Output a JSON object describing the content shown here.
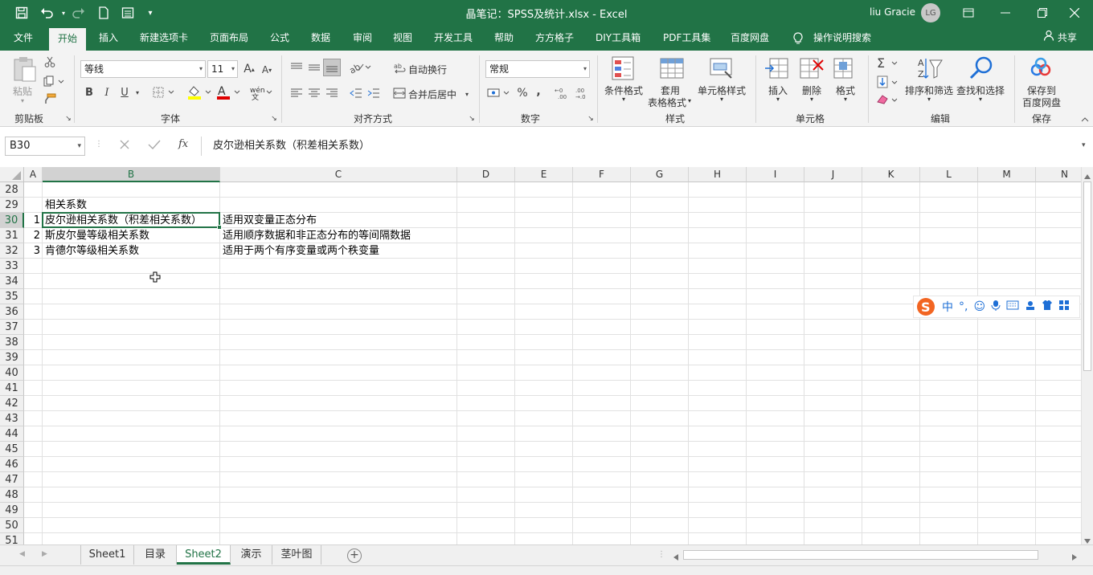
{
  "window": {
    "title": "晶笔记：SPSS及统计.xlsx  -  Excel",
    "user_name": "liu Gracie",
    "avatar_initials": "LG"
  },
  "quick_access": {
    "save_icon": "save-icon",
    "undo_icon": "undo-icon",
    "redo_icon": "redo-icon",
    "new_icon": "new-file-icon",
    "form_icon": "form-icon",
    "customize_icon": "customize-icon"
  },
  "menu_tabs": [
    "文件",
    "开始",
    "插入",
    "新建选项卡",
    "页面布局",
    "公式",
    "数据",
    "审阅",
    "视图",
    "开发工具",
    "帮助",
    "方方格子",
    "DIY工具箱",
    "PDF工具集",
    "百度网盘",
    "操作说明搜索"
  ],
  "share_label": "共享",
  "ribbon": {
    "clipboard": {
      "paste": "粘贴",
      "group": "剪贴板"
    },
    "font": {
      "name": "等线",
      "size": "11",
      "bold": "B",
      "italic": "I",
      "underline": "U",
      "group": "字体",
      "increase": "A",
      "decrease": "A"
    },
    "align": {
      "wrap": "自动换行",
      "merge": "合并后居中",
      "group": "对齐方式"
    },
    "number": {
      "format": "常规",
      "percent": "%",
      "comma": ",",
      "group": "数字"
    },
    "styles": {
      "conditional": "条件格式",
      "table1": "套用",
      "table2": "表格格式",
      "cell_style": "单元格样式",
      "group": "样式"
    },
    "cells": {
      "insert": "插入",
      "delete": "删除",
      "format": "格式",
      "group": "单元格"
    },
    "editing": {
      "sort": "排序和筛选",
      "find": "查找和选择",
      "group": "编辑"
    },
    "save": {
      "label1": "保存到",
      "label2": "百度网盘",
      "group": "保存"
    }
  },
  "formula_bar": {
    "name_box": "B30",
    "fx": "fx",
    "content": "皮尔逊相关系数（积差相关系数）"
  },
  "columns": [
    "A",
    "B",
    "C",
    "D",
    "E",
    "F",
    "G",
    "H",
    "I",
    "J",
    "K",
    "L",
    "M",
    "N"
  ],
  "rows": [
    "28",
    "29",
    "30",
    "31",
    "32",
    "33",
    "34",
    "35",
    "36",
    "37",
    "38",
    "39",
    "40",
    "41",
    "42",
    "43",
    "44",
    "45",
    "46",
    "47",
    "48",
    "49",
    "50",
    "51"
  ],
  "cells": {
    "B29": "相关系数",
    "A30": "1",
    "B30": "皮尔逊相关系数（积差相关系数）",
    "C30": "适用双变量正态分布",
    "A31": "2",
    "B31": "斯皮尔曼等级相关系数",
    "C31": "适用顺序数据和非正态分布的等间隔数据",
    "A32": "3",
    "B32": "肯德尔等级相关系数",
    "C32": "适用于两个有序变量或两个秩变量"
  },
  "sheet_tabs": [
    "Sheet1",
    "目录",
    "Sheet2",
    "演示",
    "茎叶图"
  ],
  "active_sheet": "Sheet2",
  "ime": {
    "lang": "中"
  },
  "colors": {
    "accent": "#217346",
    "ribbon_bg": "#f3f3f3",
    "grid_line": "#e1e1e1"
  }
}
